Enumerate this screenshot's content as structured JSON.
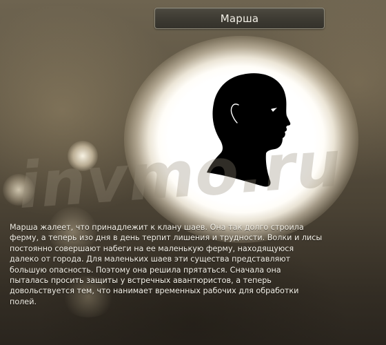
{
  "dialog": {
    "title": "Марша",
    "portrait_icon": "head-silhouette-icon",
    "description_lines": [
      "Марша жалеет, что принадлежит к клану шаев. Она так долго строила",
      "ферму, а теперь изо дня в день терпит лишения и трудности. Волки и лисы",
      "постоянно совершают набеги на ее маленькую ферму, находящуюся",
      "далеко от города. Для маленьких шаев эти существа представляют",
      "большую опасность. Поэтому она решила прятаться. Сначала она",
      "пыталась просить защиты у встречных авантюристов, а теперь",
      "довольствуется тем, что нанимает временных рабочих для обработки",
      "полей."
    ]
  },
  "watermark": {
    "text": "invmo.ru"
  },
  "colors": {
    "text": "#f4f1e8",
    "title_bar_bg": "#3e3b33",
    "title_bar_border": "#8c8878",
    "silhouette": "#000000",
    "glow": "#ffffff"
  }
}
